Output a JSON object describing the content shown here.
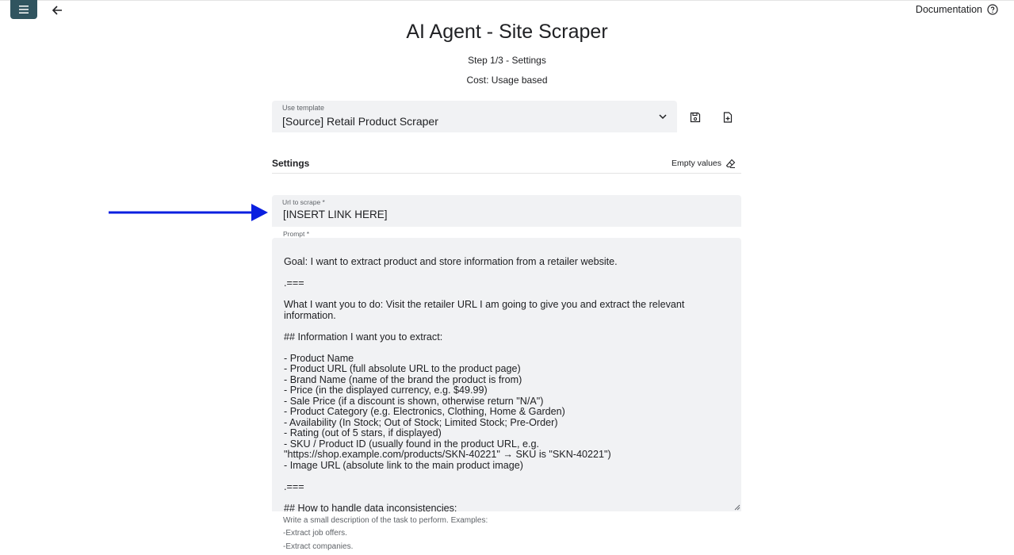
{
  "header": {
    "menu_icon": "hamburger-menu-icon",
    "back_icon": "arrow-left-icon",
    "documentation_label": "Documentation",
    "documentation_icon": "help-circle-icon"
  },
  "page": {
    "title": "AI Agent - Site Scraper",
    "step": "Step 1/3 - Settings",
    "cost": "Cost: Usage based"
  },
  "template": {
    "label": "Use template",
    "value": "[Source] Retail Product Scraper",
    "dropdown_icon": "chevron-down-icon",
    "save_icon": "save-icon",
    "new_file_icon": "file-plus-icon"
  },
  "settings": {
    "title": "Settings",
    "empty_values_label": "Empty values",
    "empty_values_icon": "eraser-icon"
  },
  "url_field": {
    "label": "Url to scrape *",
    "value": "[INSERT LINK HERE]"
  },
  "prompt": {
    "label": "Prompt *",
    "value": "Goal: I want to extract product and store information from a retailer website.\n\n.===\n\nWhat I want you to do: Visit the retailer URL I am going to give you and extract the relevant\ninformation.\n\n## Information I want you to extract:\n\n- Product Name\n- Product URL (full absolute URL to the product page)\n- Brand Name (name of the brand the product is from)\n- Price (in the displayed currency, e.g. $49.99)\n- Sale Price (if a discount is shown, otherwise return \"N/A\")\n- Product Category (e.g. Electronics, Clothing, Home & Garden)\n- Availability (In Stock; Out of Stock; Limited Stock; Pre-Order)\n- Rating (out of 5 stars, if displayed)\n- SKU / Product ID (usually found in the product URL, e.g.\n\"https://shop.example.com/products/SKN-40221\" → SKU is \"SKN-40221\")\n- Image URL (absolute link to the main product image)\n\n.===\n\n## How to handle data inconsistencies:"
  },
  "help": {
    "line1": "Write a small description of the task to perform. Examples:",
    "line2": "-Extract job offers.",
    "line3": "-Extract companies."
  },
  "colors": {
    "menu_button": "#30545f",
    "field_background": "#f1f2f4",
    "annotation_arrow": "#0a1fe0"
  }
}
